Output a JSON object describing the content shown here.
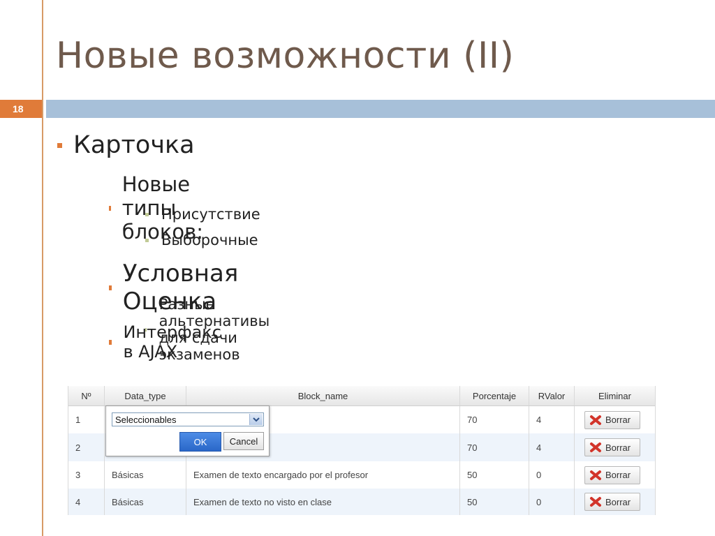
{
  "slide": {
    "title": "Новые возможности (II)",
    "number": "18"
  },
  "outline": {
    "l1": "Карточка",
    "l2a": "Новые типы блоков:",
    "l3a": "Присутствие",
    "l3b": "Выборочные",
    "l2b": "Условная Оценка",
    "l3c": "Разные альтернативы для сдачи экзаменов",
    "l2c": "Интерфакс в AJAX"
  },
  "grid": {
    "columns": [
      "Nº",
      "Data_type",
      "Block_name",
      "Porcentaje",
      "RValor",
      "Eliminar"
    ],
    "rows": [
      {
        "num": "1",
        "type": "",
        "name": "",
        "pct": "70",
        "rvalor": "4",
        "action": "Borrar"
      },
      {
        "num": "2",
        "type": "",
        "name": "",
        "pct": "70",
        "rvalor": "4",
        "action": "Borrar"
      },
      {
        "num": "3",
        "type": "Básicas",
        "name": "Examen de texto encargado por el profesor",
        "pct": "50",
        "rvalor": "0",
        "action": "Borrar"
      },
      {
        "num": "4",
        "type": "Básicas",
        "name": "Examen de texto no visto en clase",
        "pct": "50",
        "rvalor": "0",
        "action": "Borrar"
      }
    ]
  },
  "editor": {
    "selected": "Seleccionables",
    "ok_label": "OK",
    "cancel_label": "Cancel"
  },
  "colors": {
    "accent_orange": "#e07b39",
    "band_blue": "#a7c0d9",
    "title_brown": "#6f5a4c",
    "row_alt": "#eef4fb",
    "ok_blue": "#2a67c8"
  },
  "icons": {
    "delete": "red-x-icon",
    "dropdown": "chevron-down-icon"
  }
}
